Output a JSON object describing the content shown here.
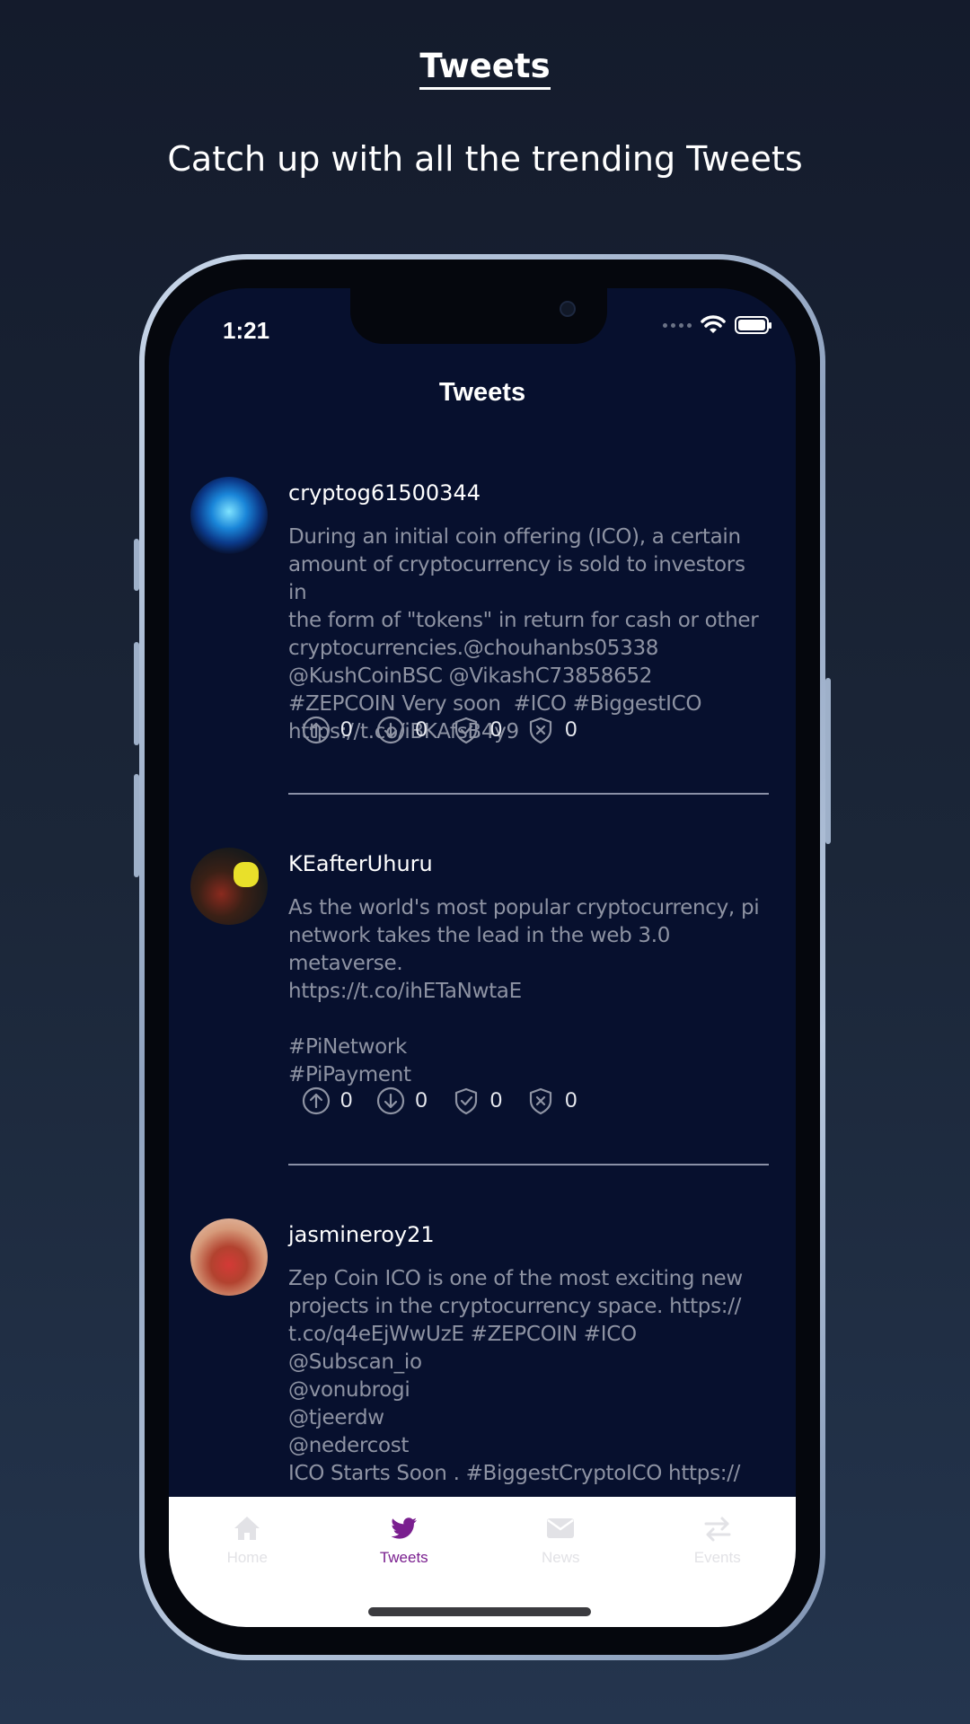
{
  "promo": {
    "title": "Tweets",
    "subtitle": "Catch up with all the trending Tweets"
  },
  "status_bar": {
    "time": "1:21"
  },
  "app": {
    "title": "Tweets"
  },
  "tweets": [
    {
      "username": "cryptog61500344",
      "text": "During an initial coin offering (ICO), a certain\namount of cryptocurrency is sold to investors in\nthe form of \"tokens\" in return for cash or other\ncryptocurrencies.@chouhanbs05338\n@KushCoinBSC @VikashC73858652\n#ZEPCOIN Very soon  #ICO #BiggestICO\nhttps://t.co/iBKAfsB4y9",
      "upvotes": "0",
      "downvotes": "0",
      "verified": "0",
      "flagged": "0"
    },
    {
      "username": "KEafterUhuru",
      "text": "As the world's most popular cryptocurrency, pi\nnetwork takes the lead in the web 3.0\nmetaverse.\nhttps://t.co/ihETaNwtaE\n\n#PiNetwork\n#PiPayment",
      "upvotes": "0",
      "downvotes": "0",
      "verified": "0",
      "flagged": "0"
    },
    {
      "username": "jasmineroy21",
      "text": "Zep Coin ICO is one of the most exciting new\nprojects in the cryptocurrency space. https://\nt.co/q4eEjWwUzE #ZEPCOIN #ICO\n@Subscan_io\n@vonubrogi\n@tjeerdw\n@nedercost\nICO Starts Soon . #BiggestCryptoICO https://"
    }
  ],
  "tabs": [
    {
      "label": "Home",
      "icon": "home-icon",
      "active": false
    },
    {
      "label": "Tweets",
      "icon": "twitter-bird-icon",
      "active": true
    },
    {
      "label": "News",
      "icon": "mail-icon",
      "active": false
    },
    {
      "label": "Events",
      "icon": "swap-arrows-icon",
      "active": false
    }
  ],
  "colors": {
    "background": "#07102e",
    "tab_active": "#7a1f8f",
    "tab_inactive": "#e2e2e6",
    "tweet_text": "#8e93a3"
  }
}
